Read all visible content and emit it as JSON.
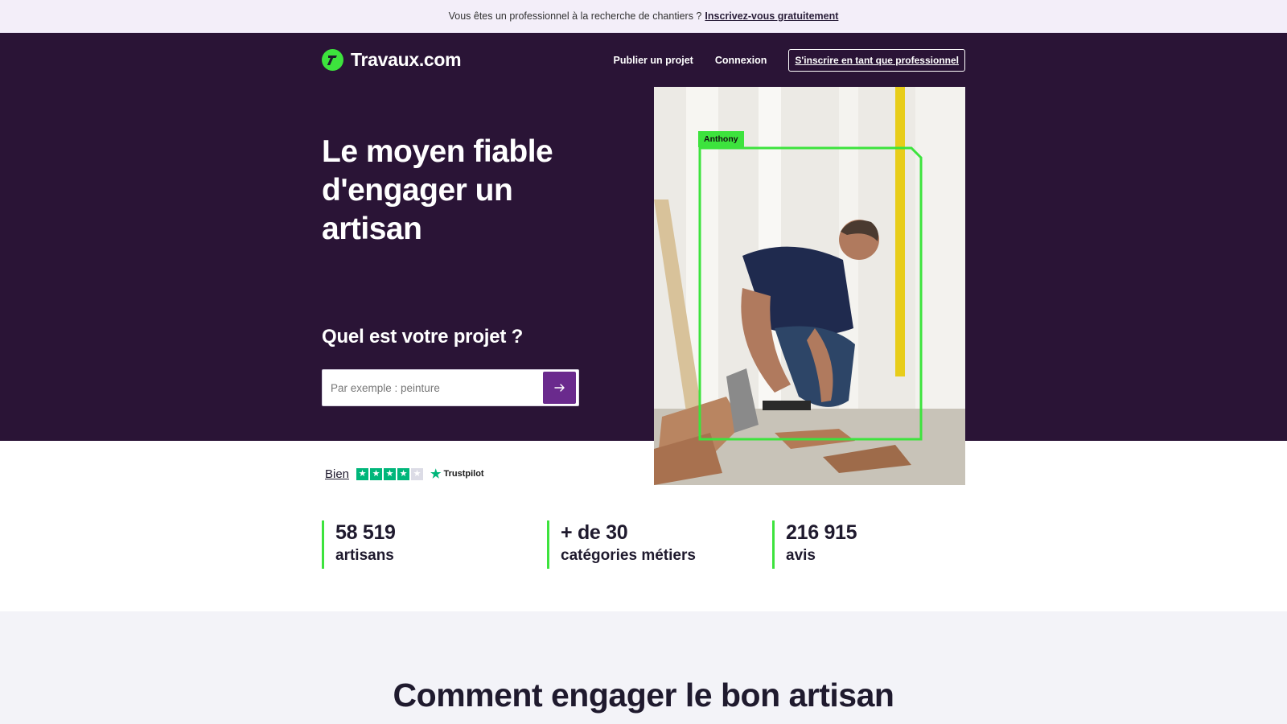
{
  "promo": {
    "text": "Vous êtes un professionnel à la recherche de chantiers ?",
    "link": "Inscrivez-vous gratuitement"
  },
  "header": {
    "logo_text": "Travaux.com",
    "nav": {
      "publish": "Publier un projet",
      "login": "Connexion",
      "pro_signup": "S'inscrire en tant que professionnel"
    }
  },
  "hero": {
    "title": "Le moyen fiable d'engager un artisan",
    "subtitle": "Quel est votre projet ?",
    "search": {
      "placeholder": "Par exemple : peinture",
      "value": ""
    },
    "photo": {
      "tag": "Anthony"
    }
  },
  "rating": {
    "label": "Bien",
    "stars_filled": 4,
    "stars_total": 5,
    "provider": "Trustpilot"
  },
  "stats": [
    {
      "value": "58 519",
      "label": "artisans"
    },
    {
      "value": "+ de 30",
      "label": "catégories métiers"
    },
    {
      "value": "216 915",
      "label": "avis"
    }
  ],
  "how": {
    "title": "Comment engager le bon artisan"
  },
  "colors": {
    "hero_bg": "#2a1436",
    "accent_green": "#3de33d",
    "search_button": "#6a2a8d",
    "trustpilot_green": "#00b67a"
  }
}
